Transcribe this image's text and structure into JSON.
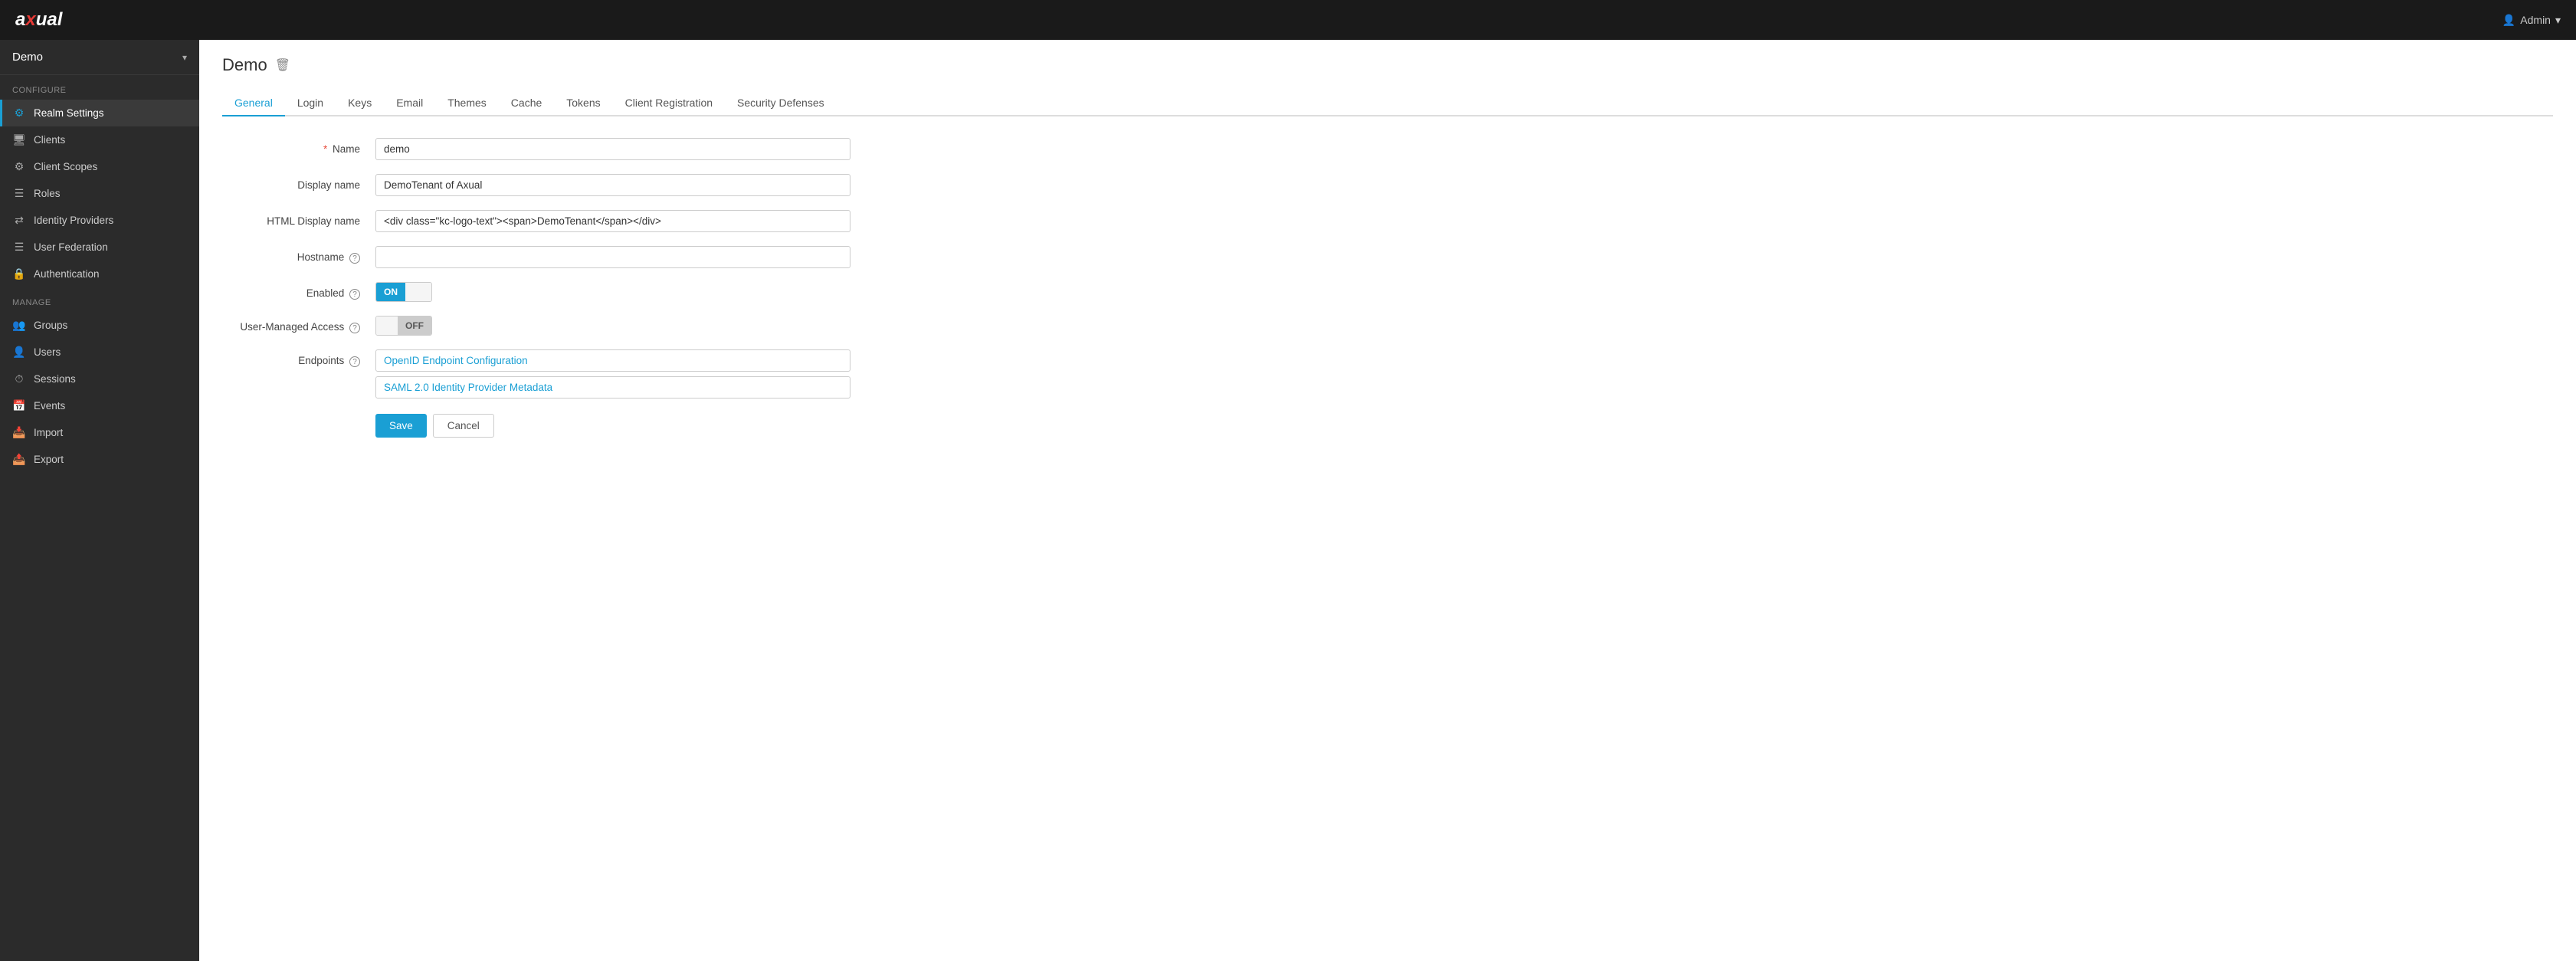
{
  "navbar": {
    "logo": "axual",
    "user_label": "Admin",
    "user_icon": "👤"
  },
  "sidebar": {
    "realm_name": "Demo",
    "configure_label": "Configure",
    "manage_label": "Manage",
    "configure_items": [
      {
        "id": "realm-settings",
        "label": "Realm Settings",
        "icon": "⚙",
        "active": true
      },
      {
        "id": "clients",
        "label": "Clients",
        "icon": "🖥"
      },
      {
        "id": "client-scopes",
        "label": "Client Scopes",
        "icon": "⚙"
      },
      {
        "id": "roles",
        "label": "Roles",
        "icon": "☰"
      },
      {
        "id": "identity-providers",
        "label": "Identity Providers",
        "icon": "⇄"
      },
      {
        "id": "user-federation",
        "label": "User Federation",
        "icon": "☰"
      },
      {
        "id": "authentication",
        "label": "Authentication",
        "icon": "🔒"
      }
    ],
    "manage_items": [
      {
        "id": "groups",
        "label": "Groups",
        "icon": "👥"
      },
      {
        "id": "users",
        "label": "Users",
        "icon": "👤"
      },
      {
        "id": "sessions",
        "label": "Sessions",
        "icon": "⏱"
      },
      {
        "id": "events",
        "label": "Events",
        "icon": "📅"
      },
      {
        "id": "import",
        "label": "Import",
        "icon": "📥"
      },
      {
        "id": "export",
        "label": "Export",
        "icon": "📤"
      }
    ]
  },
  "page": {
    "title": "Demo",
    "delete_icon": "🗑"
  },
  "tabs": [
    {
      "id": "general",
      "label": "General",
      "active": true
    },
    {
      "id": "login",
      "label": "Login"
    },
    {
      "id": "keys",
      "label": "Keys"
    },
    {
      "id": "email",
      "label": "Email"
    },
    {
      "id": "themes",
      "label": "Themes"
    },
    {
      "id": "cache",
      "label": "Cache"
    },
    {
      "id": "tokens",
      "label": "Tokens"
    },
    {
      "id": "client-registration",
      "label": "Client Registration"
    },
    {
      "id": "security-defenses",
      "label": "Security Defenses"
    }
  ],
  "form": {
    "name_label": "Name",
    "name_required": "*",
    "name_value": "demo",
    "display_name_label": "Display name",
    "display_name_value": "DemoTenant of Axual",
    "html_display_name_label": "HTML Display name",
    "html_display_name_value": "<div class=\"kc-logo-text\"><span>DemoTenant</span></div>",
    "hostname_label": "Hostname",
    "hostname_value": "",
    "enabled_label": "Enabled",
    "enabled_on": "ON",
    "enabled_off": "OFF",
    "user_managed_access_label": "User-Managed Access",
    "uma_off": "OFF",
    "endpoints_label": "Endpoints",
    "endpoints": [
      {
        "id": "openid-endpoint",
        "label": "OpenID Endpoint Configuration"
      },
      {
        "id": "saml-metadata",
        "label": "SAML 2.0 Identity Provider Metadata"
      }
    ],
    "save_label": "Save",
    "cancel_label": "Cancel"
  }
}
